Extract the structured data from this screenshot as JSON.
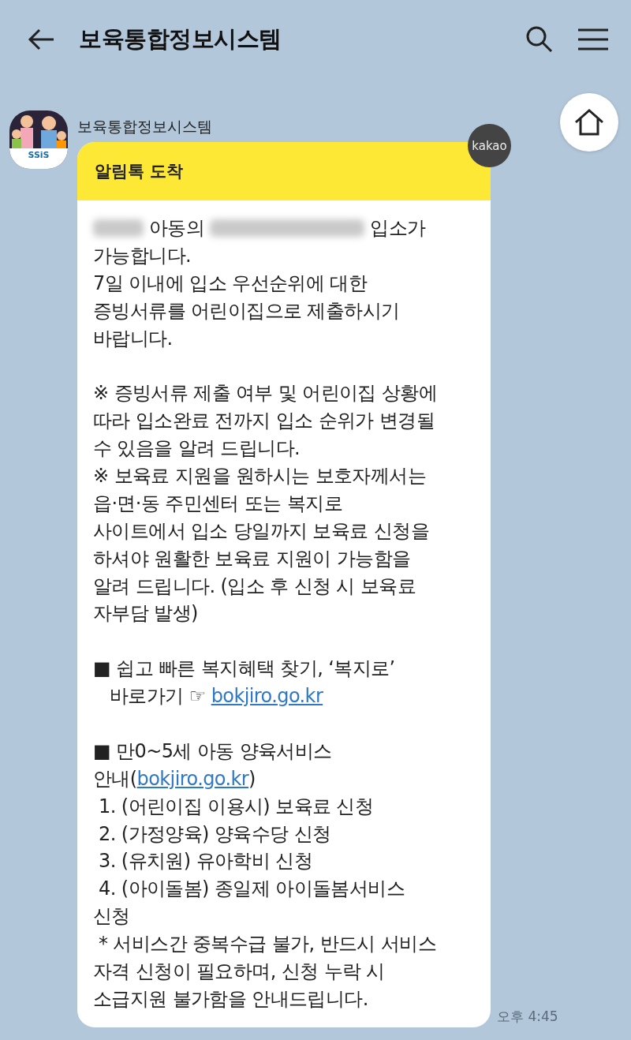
{
  "top_bar": {
    "title": "보육통합정보시스템"
  },
  "message": {
    "sender": "보육통합정보시스템",
    "avatar_logo": "SSiS",
    "badge": "kakao",
    "header": "알림톡 도착",
    "time": "오후 4:45",
    "body": [
      {
        "kind": "mixed",
        "parts": [
          {
            "kind": "blur"
          },
          {
            "kind": "text",
            "text": " 아동의 "
          },
          {
            "kind": "blur"
          },
          {
            "kind": "text",
            "text": " 입소가"
          }
        ]
      },
      {
        "kind": "text",
        "text": "가능합니다."
      },
      {
        "kind": "text",
        "text": "7일 이내에 입소 우선순위에 대한"
      },
      {
        "kind": "text",
        "text": "증빙서류를 어린이집으로 제출하시기"
      },
      {
        "kind": "text",
        "text": "바랍니다."
      },
      {
        "kind": "blank"
      },
      {
        "kind": "text",
        "text": "※ 증빙서류 제출 여부 및 어린이집 상황에"
      },
      {
        "kind": "text",
        "text": "따라 입소완료 전까지 입소 순위가 변경될"
      },
      {
        "kind": "text",
        "text": "수 있음을 알려 드립니다."
      },
      {
        "kind": "text",
        "text": "※ 보육료 지원을 원하시는 보호자께서는"
      },
      {
        "kind": "text",
        "text": "읍·면·동 주민센터 또는 복지로"
      },
      {
        "kind": "text",
        "text": "사이트에서 입소 당일까지 보육료 신청을"
      },
      {
        "kind": "text",
        "text": "하셔야 원활한 보육료 지원이 가능함을"
      },
      {
        "kind": "text",
        "text": "알려 드립니다. (입소 후 신청 시 보육료"
      },
      {
        "kind": "text",
        "text": "자부담 발생)"
      },
      {
        "kind": "blank"
      },
      {
        "kind": "text",
        "text": "■ 쉽고 빠른 복지혜택 찾기, ‘복지로’"
      },
      {
        "kind": "mixed",
        "parts": [
          {
            "kind": "text",
            "text": "   바로가기 ☞ "
          },
          {
            "kind": "link",
            "text": "bokjiro.go.kr"
          }
        ]
      },
      {
        "kind": "blank"
      },
      {
        "kind": "text",
        "text": "■ 만0~5세 아동 양육서비스"
      },
      {
        "kind": "mixed",
        "parts": [
          {
            "kind": "text",
            "text": "안내("
          },
          {
            "kind": "link",
            "text": "bokjiro.go.kr"
          },
          {
            "kind": "text",
            "text": ")"
          }
        ]
      },
      {
        "kind": "text",
        "text": " 1. (어린이집 이용시) 보육료 신청"
      },
      {
        "kind": "text",
        "text": " 2. (가정양육) 양육수당 신청"
      },
      {
        "kind": "text",
        "text": " 3. (유치원) 유아학비 신청"
      },
      {
        "kind": "text",
        "text": " 4. (아이돌봄) 종일제 아이돌봄서비스"
      },
      {
        "kind": "text",
        "text": "신청"
      },
      {
        "kind": "text",
        "text": " * 서비스간 중복수급 불가, 반드시 서비스"
      },
      {
        "kind": "text",
        "text": "자격 신청이 필요하며, 신청 누락 시"
      },
      {
        "kind": "text",
        "text": "소급지원 불가함을 안내드립니다."
      }
    ]
  }
}
